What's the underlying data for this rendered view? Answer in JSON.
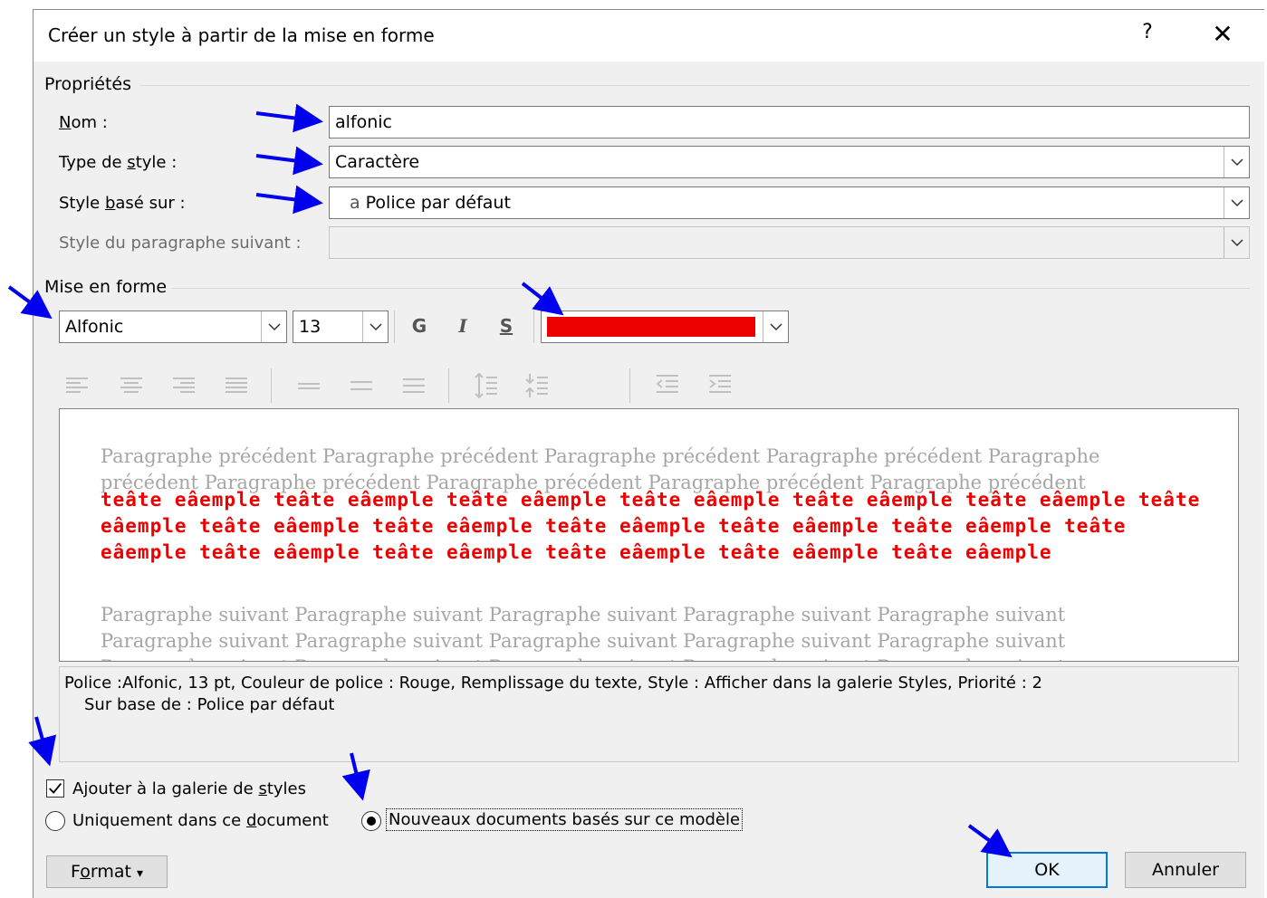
{
  "dialog": {
    "title": "Créer un style à partir de la mise en forme",
    "help_label": "?",
    "close_label": "✕"
  },
  "properties": {
    "section_label": "Propriétés",
    "name_label_pre": "",
    "name_label_u": "N",
    "name_label_post": "om :",
    "name_value": "alfonic",
    "type_label_pre": "Type de ",
    "type_label_u": "s",
    "type_label_post": "tyle :",
    "type_value": "Caractère",
    "based_label_pre": "Style ",
    "based_label_u": "b",
    "based_label_post": "asé sur :",
    "based_glyph": "a",
    "based_value": "Police par défaut",
    "next_label": "Style du paragraphe suivant :",
    "next_value": ""
  },
  "formatting": {
    "section_label": "Mise en forme",
    "font_value": "Alfonic",
    "size_value": "13",
    "bold_label": "G",
    "italic_label": "I",
    "underline_label": "S",
    "font_color": "#ee0000"
  },
  "preview": {
    "previous_paragraph": "Paragraphe précédent Paragraphe précédent Paragraphe précédent Paragraphe précédent Paragraphe précédent Paragraphe précédent Paragraphe précédent Paragraphe précédent Paragraphe précédent",
    "sample_text": "teâte eâemple teâte eâemple teâte eâemple teâte eâemple teâte eâemple teâte eâemple teâte eâemple teâte eâemple teâte eâemple teâte eâemple teâte eâemple teâte eâemple teâte eâemple teâte eâemple teâte eâemple teâte eâemple teâte eâemple teâte eâemple",
    "next_paragraph": "Paragraphe suivant Paragraphe suivant Paragraphe suivant Paragraphe suivant Paragraphe suivant Paragraphe suivant Paragraphe suivant Paragraphe suivant Paragraphe suivant Paragraphe suivant Paragraphe suivant Paragraphe suivant Paragraphe suivant Paragraphe suivant Paragraphe suivant Paragraphe suivant"
  },
  "description": {
    "line1": "Police :Alfonic, 13 pt, Couleur de police : Rouge, Remplissage du texte, Style : Afficher dans la galerie Styles, Priorité : 2",
    "line2": "Sur base de : Police par défaut"
  },
  "options": {
    "add_gallery_pre": "Ajouter à la galerie de ",
    "add_gallery_u": "s",
    "add_gallery_post": "tyles",
    "add_gallery_checked": true,
    "only_doc_pre": "Uniquement dans ce ",
    "only_doc_u": "d",
    "only_doc_post": "ocument",
    "new_docs_label": "Nouveaux documents basés sur ce modèle",
    "selected_scope": "new_docs"
  },
  "buttons": {
    "format_pre": "F",
    "format_u": "o",
    "format_post": "rmat",
    "format_arrow": "▾",
    "ok_label": "OK",
    "cancel_label": "Annuler"
  },
  "annotations": {
    "arrow_color": "#0000ee"
  }
}
